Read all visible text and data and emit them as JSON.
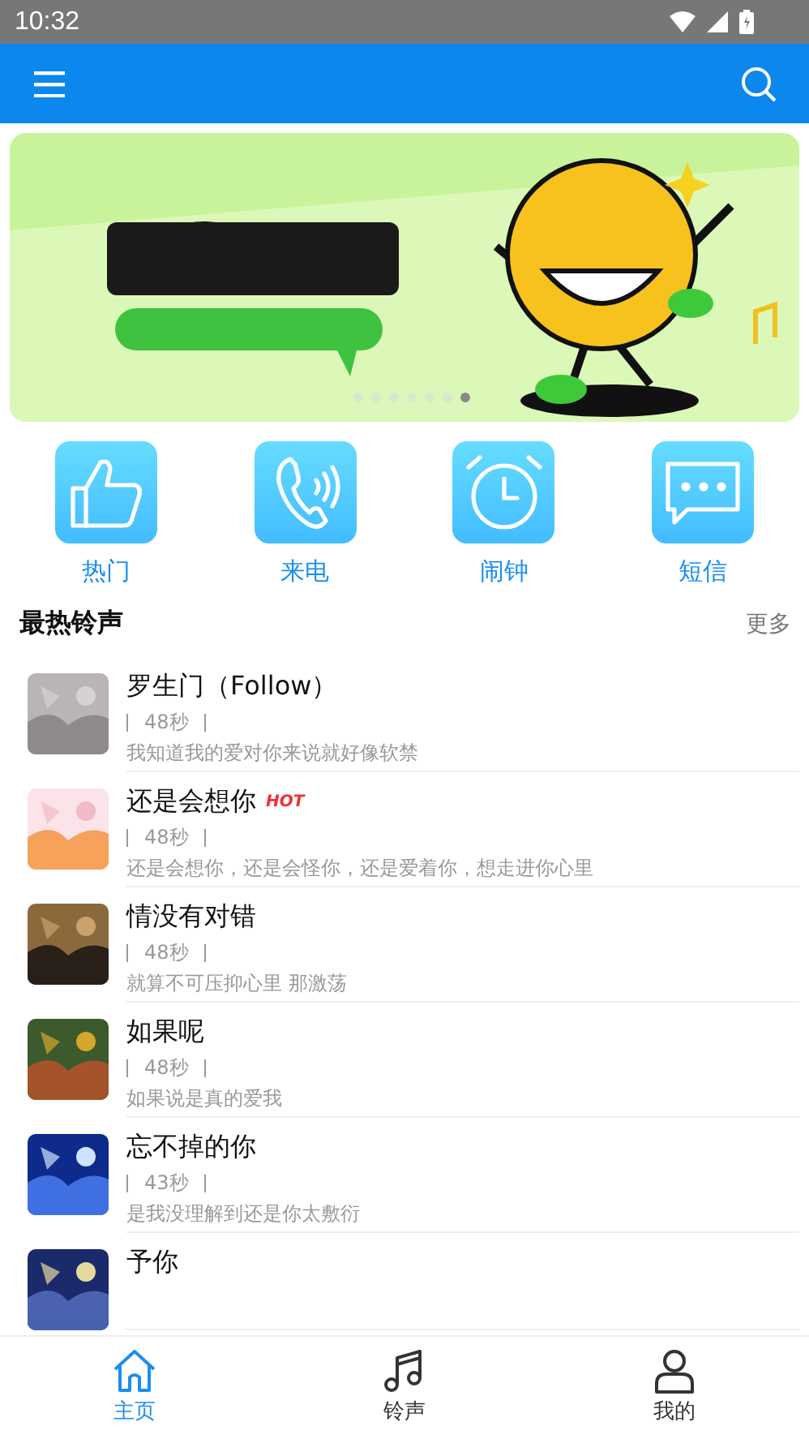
{
  "status_bar": {
    "time": "10:32"
  },
  "banner": {
    "dots": [
      {
        "selected": false
      },
      {
        "selected": false
      },
      {
        "selected": false
      },
      {
        "selected": false
      },
      {
        "selected": false
      },
      {
        "selected": false
      },
      {
        "selected": true
      }
    ]
  },
  "categories": [
    {
      "label": "热门"
    },
    {
      "label": "来电"
    },
    {
      "label": "闹钟"
    },
    {
      "label": "短信"
    }
  ],
  "section": {
    "title": "最热铃声",
    "more": "更多"
  },
  "songs": [
    {
      "title": "罗生门（Follow）",
      "duration": "48秒",
      "lyric": "我知道我的爱对你来说就好像软禁"
    },
    {
      "title": "还是会想你",
      "badge": "HOT",
      "duration": "48秒",
      "lyric": "还是会想你，还是会怪你，还是爱着你，想走进你心里"
    },
    {
      "title": "情没有对错",
      "duration": "48秒",
      "lyric": "就算不可压抑心里 那激荡"
    },
    {
      "title": "如果呢",
      "duration": "48秒",
      "lyric": "如果说是真的爱我"
    },
    {
      "title": "忘不掉的你",
      "duration": "43秒",
      "lyric": "是我没理解到还是你太敷衍"
    },
    {
      "title": "予你"
    }
  ],
  "tabs": [
    {
      "label": "主页",
      "selected": true
    },
    {
      "label": "铃声",
      "selected": false
    },
    {
      "label": "我的",
      "selected": false
    }
  ]
}
